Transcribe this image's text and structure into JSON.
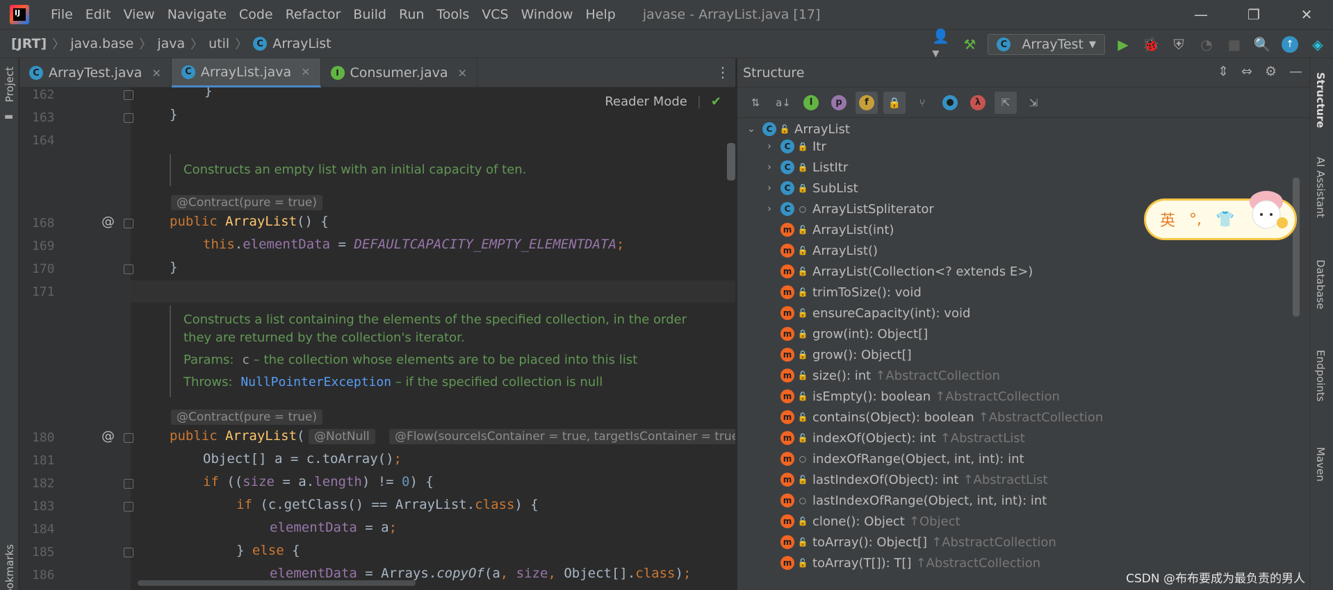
{
  "window": {
    "title": "javase - ArrayList.java [17]",
    "menu": [
      "File",
      "Edit",
      "View",
      "Navigate",
      "Code",
      "Refactor",
      "Build",
      "Run",
      "Tools",
      "VCS",
      "Window",
      "Help"
    ]
  },
  "navbar": {
    "breadcrumbs": [
      "[JRT]",
      "java.base",
      "java",
      "util",
      "ArrayList"
    ],
    "run_config": "ArrayTest"
  },
  "left_stripe": {
    "project": "Project",
    "bookmarks": "Bookmarks"
  },
  "right_stripe": [
    "Structure",
    "AI Assistant",
    "Database",
    "Endpoints",
    "Maven"
  ],
  "tabs": [
    {
      "label": "ArrayTest.java",
      "badge": "C",
      "active": false
    },
    {
      "label": "ArrayList.java",
      "badge": "C",
      "active": true
    },
    {
      "label": "Consumer.java",
      "badge": "I",
      "active": false
    }
  ],
  "editor": {
    "reader_mode": "Reader Mode",
    "line_numbers": [
      "162",
      "163",
      "164",
      "168",
      "169",
      "170",
      "171",
      "180",
      "181",
      "182",
      "183",
      "184",
      "185",
      "186"
    ],
    "doc1": "Constructs an empty list with an initial capacity of ten.",
    "contract1": "@Contract(pure = true)",
    "doc2_line1": "Constructs a list containing the elements of the specified collection, in the order",
    "doc2_line2": "they are returned by the collection's iterator.",
    "params_label": "Params:",
    "params_code": "c",
    "params_text": "– the collection whose elements are to be placed into this list",
    "throws_label": "Throws:",
    "throws_link": "NullPointerException",
    "throws_text": "– if the specified collection is null",
    "contract2": "@Contract(pure = true)",
    "notnull": "@NotNull",
    "flow": "@Flow(sourceIsContainer = true, targetIsContainer = true"
  },
  "structure": {
    "title": "Structure",
    "items": [
      {
        "text": "ArrayList",
        "kind": "C",
        "vis": "pub",
        "level": 0,
        "expand": "open"
      },
      {
        "text": "Itr",
        "kind": "C",
        "vis": "priv",
        "level": 1,
        "expand": "closed"
      },
      {
        "text": "ListItr",
        "kind": "C",
        "vis": "priv",
        "level": 1,
        "expand": "closed"
      },
      {
        "text": "SubList",
        "kind": "C",
        "vis": "priv",
        "level": 1,
        "expand": "closed"
      },
      {
        "text": "ArrayListSpliterator",
        "kind": "C",
        "vis": "pkg",
        "level": 1,
        "expand": "closed"
      },
      {
        "text": "ArrayList(int)",
        "kind": "m",
        "vis": "pub",
        "level": 1
      },
      {
        "text": "ArrayList()",
        "kind": "m",
        "vis": "pub",
        "level": 1
      },
      {
        "text": "ArrayList(Collection<? extends E>)",
        "kind": "m",
        "vis": "pub",
        "level": 1
      },
      {
        "text": "trimToSize(): void",
        "kind": "m",
        "vis": "pub",
        "level": 1
      },
      {
        "text": "ensureCapacity(int): void",
        "kind": "m",
        "vis": "pub",
        "level": 1
      },
      {
        "text": "grow(int): Object[]",
        "kind": "m",
        "vis": "priv",
        "level": 1
      },
      {
        "text": "grow(): Object[]",
        "kind": "m",
        "vis": "priv",
        "level": 1
      },
      {
        "text": "size(): int",
        "inherit": "↑AbstractCollection",
        "kind": "m",
        "vis": "pub",
        "level": 1
      },
      {
        "text": "isEmpty(): boolean",
        "inherit": "↑AbstractCollection",
        "kind": "m",
        "vis": "pub",
        "level": 1
      },
      {
        "text": "contains(Object): boolean",
        "inherit": "↑AbstractCollection",
        "kind": "m",
        "vis": "pub",
        "level": 1
      },
      {
        "text": "indexOf(Object): int",
        "inherit": "↑AbstractList",
        "kind": "m",
        "vis": "pub",
        "level": 1
      },
      {
        "text": "indexOfRange(Object, int, int): int",
        "kind": "m",
        "vis": "pkg",
        "level": 1
      },
      {
        "text": "lastIndexOf(Object): int",
        "inherit": "↑AbstractList",
        "kind": "m",
        "vis": "pub",
        "level": 1
      },
      {
        "text": "lastIndexOfRange(Object, int, int): int",
        "kind": "m",
        "vis": "pkg",
        "level": 1
      },
      {
        "text": "clone(): Object",
        "inherit": "↑Object",
        "kind": "m",
        "vis": "pub",
        "level": 1
      },
      {
        "text": "toArray(): Object[]",
        "inherit": "↑AbstractCollection",
        "kind": "m",
        "vis": "pub",
        "level": 1
      },
      {
        "text": "toArray(T[]): T[]",
        "inherit": "↑AbstractCollection",
        "kind": "m",
        "vis": "pub",
        "level": 1
      }
    ]
  },
  "ime": {
    "label": "英",
    "punct": "°,",
    "shirt": "👕"
  },
  "watermark": "CSDN @布布要成为最负责的男人",
  "colors": {
    "keyword": "#cc7832",
    "method": "#ffc66d",
    "field": "#9876aa",
    "doc": "#629755",
    "accent": "#3592c4"
  }
}
